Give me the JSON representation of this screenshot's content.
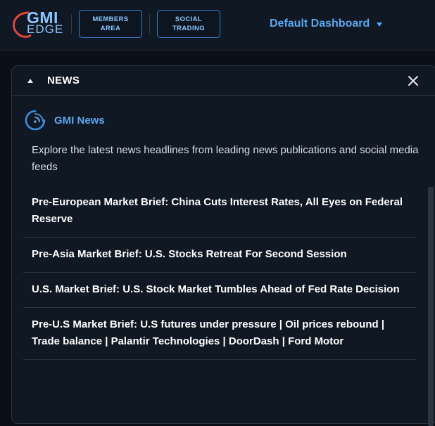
{
  "header": {
    "logo": {
      "line1": "GMI",
      "line2": "EDGE"
    },
    "members_button": "MEMBERS\nAREA",
    "social_button": "SOCIAL\nTRADING",
    "dashboard_select": "Default Dashboard"
  },
  "panel": {
    "title": "NEWS",
    "source_name": "GMI News",
    "source_icon": "rss-icon",
    "description": "Explore the latest news headlines from leading news publications and social media feeds",
    "items": [
      {
        "headline": "Pre-European Market Brief: China Cuts Interest Rates, All Eyes on Federal Reserve"
      },
      {
        "headline": "Pre-Asia Market Brief: U.S. Stocks Retreat For Second Session"
      },
      {
        "headline": "U.S. Market Brief: U.S. Stock Market Tumbles Ahead of Fed Rate Decision"
      },
      {
        "headline": "Pre-U.S Market Brief: U.S futures under pressure | Oil prices rebound | Trade balance | Palantir Technologies | DoorDash | Ford Motor"
      }
    ]
  },
  "colors": {
    "accent": "#5aa7ee",
    "logo_red": "#e0473c",
    "background": "#0b1018",
    "panel": "#101823"
  }
}
